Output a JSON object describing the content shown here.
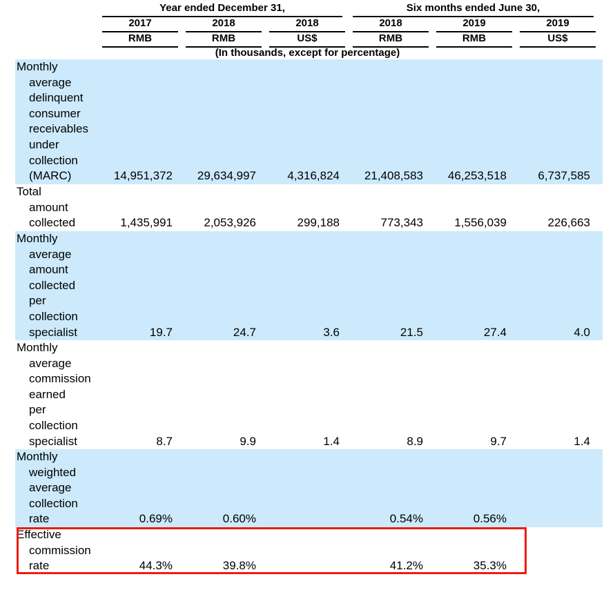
{
  "table": {
    "units_caption": "(In thousands, except for percentage)",
    "group_headers": [
      {
        "label": "Year ended December 31,"
      },
      {
        "label": "Six months ended June 30,"
      }
    ],
    "columns": [
      {
        "year": "2017",
        "currency": "RMB"
      },
      {
        "year": "2018",
        "currency": "RMB"
      },
      {
        "year": "2018",
        "currency": "US$"
      },
      {
        "year": "2018",
        "currency": "RMB"
      },
      {
        "year": "2019",
        "currency": "RMB"
      },
      {
        "year": "2019",
        "currency": "US$"
      }
    ],
    "rows": [
      {
        "label": "Monthly average delinquent consumer receivables under collection (MARC)",
        "shaded": true,
        "highlighted": false,
        "values": [
          "14,951,372",
          "29,634,997",
          "4,316,824",
          "21,408,583",
          "46,253,518",
          "6,737,585"
        ]
      },
      {
        "label": "Total amount collected",
        "shaded": false,
        "highlighted": false,
        "values": [
          "1,435,991",
          "2,053,926",
          "299,188",
          "773,343",
          "1,556,039",
          "226,663"
        ]
      },
      {
        "label": "Monthly average amount collected per collection specialist",
        "shaded": true,
        "highlighted": false,
        "values": [
          "19.7",
          "24.7",
          "3.6",
          "21.5",
          "27.4",
          "4.0"
        ]
      },
      {
        "label": "Monthly average commission earned per collection specialist",
        "shaded": false,
        "highlighted": false,
        "values": [
          "8.7",
          "9.9",
          "1.4",
          "8.9",
          "9.7",
          "1.4"
        ]
      },
      {
        "label": "Monthly weighted average collection rate",
        "shaded": true,
        "highlighted": false,
        "values": [
          "0.69%",
          "0.60%",
          "",
          "0.54%",
          "0.56%",
          ""
        ]
      },
      {
        "label": "Effective commission rate",
        "shaded": false,
        "highlighted": true,
        "values": [
          "44.3%",
          "39.8%",
          "",
          "41.2%",
          "35.3%",
          ""
        ]
      }
    ],
    "colors": {
      "shaded_row": "#cceafb",
      "highlight_border": "#ee1b11",
      "text": "#000000"
    }
  }
}
